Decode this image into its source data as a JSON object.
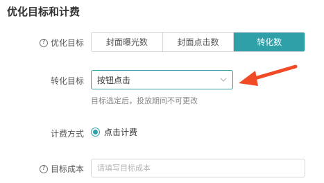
{
  "section_title": "优化目标和计费",
  "optimize_target": {
    "label": "优化目标",
    "help_icon": "question-circle-icon",
    "options": [
      "封面曝光数",
      "封面点击数",
      "转化数"
    ],
    "selected": "转化数"
  },
  "conversion_target": {
    "label": "转化目标",
    "value": "按钮点击",
    "chevron_icon": "chevron-down-icon",
    "hint": "目标选定后，投放期间不可更改"
  },
  "billing": {
    "label": "计费方式",
    "option": "点击计费"
  },
  "target_cost": {
    "label": "目标成本",
    "help_icon": "question-circle-icon",
    "placeholder": "请填写目标成本"
  },
  "colors": {
    "accent": "#2fa0a7",
    "annotation_arrow": "#f04a27"
  }
}
